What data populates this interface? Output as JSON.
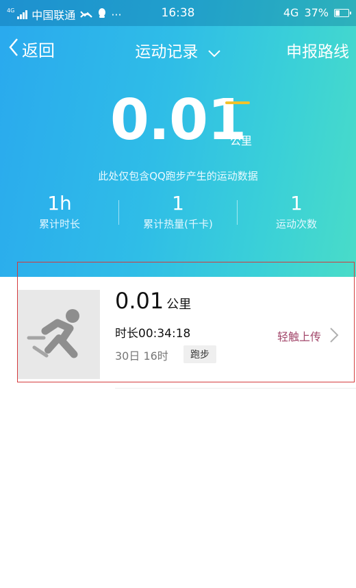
{
  "status_bar": {
    "network_tag": "4G",
    "carrier": "中国联通",
    "more": "···",
    "time": "16:38",
    "network": "4G",
    "battery_percent_label": "37%",
    "battery_level": 0.37,
    "icons": [
      "signal-icon",
      "missed-call-icon",
      "qq-penguin-icon",
      "battery-icon"
    ]
  },
  "nav": {
    "back_label": "返回",
    "title": "运动记录",
    "right_label": "申报路线"
  },
  "summary": {
    "distance_value": "0.01",
    "distance_unit": "公里",
    "note": "此处仅包含QQ跑步产生的运动数据",
    "accent_color": "#f2c22b",
    "stats": [
      {
        "value": "1h",
        "label": "累计时长"
      },
      {
        "value": "1",
        "label": "累计热量(千卡)"
      },
      {
        "value": "1",
        "label": "运动次数"
      }
    ]
  },
  "records": [
    {
      "distance": "0.01",
      "unit": "公里",
      "duration": "时长00:34:18",
      "time": "30日 16时",
      "type": "跑步",
      "action": "轻触上传",
      "icon": "runner-icon"
    }
  ],
  "colors": {
    "gradient_start": "#2aa9ee",
    "gradient_end": "#49dcc8",
    "highlight_outline": "#d4393b",
    "upload_text": "#a2466a"
  }
}
